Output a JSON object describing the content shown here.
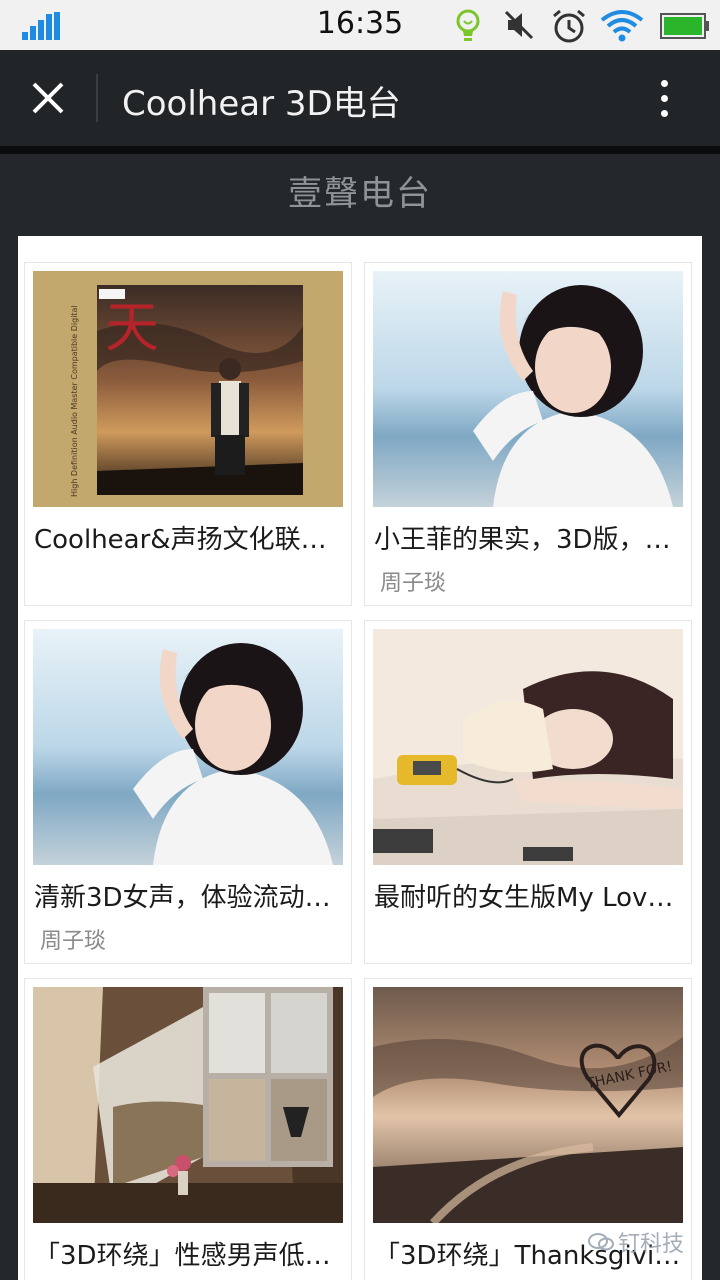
{
  "status_bar": {
    "time": "16:35",
    "icons": [
      "signal-icon",
      "bulb-icon",
      "mute-icon",
      "alarm-icon",
      "wifi-icon",
      "battery-icon"
    ]
  },
  "header": {
    "title": "Coolhear 3D电台",
    "close_icon": "close-icon",
    "more_icon": "more-vertical-icon"
  },
  "station": {
    "title": "壹聲电台"
  },
  "cards": [
    {
      "title": "Coolhear&声扬文化联…",
      "author": ""
    },
    {
      "title": "小王菲的果实，3D版，…",
      "author": "周子琰"
    },
    {
      "title": "清新3D女声，体验流动…",
      "author": "周子琰"
    },
    {
      "title": "最耐听的女生版My Lov…",
      "author": ""
    },
    {
      "title": "「3D环绕」性感男声低…",
      "author": ""
    },
    {
      "title": "「3D环绕」Thanksgivi…",
      "author": ""
    }
  ],
  "thumbnail_text": {
    "album_art_vertical": "High Definition Audio Master Compatible Digital",
    "heart_note": "THANK FOR!"
  },
  "watermark": "钉科技",
  "colors": {
    "status_bar_bg": "#f1f1f1",
    "title_bar_bg": "#212528",
    "page_bg": "#24272b",
    "accent_blue": "#1f8be2",
    "battery_green": "#2bb52b"
  }
}
